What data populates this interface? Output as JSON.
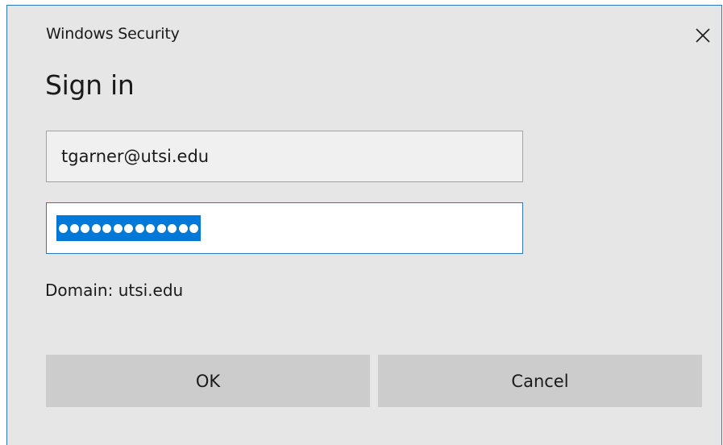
{
  "window": {
    "title": "Windows Security",
    "close_icon": "close-icon"
  },
  "form": {
    "heading": "Sign in",
    "username_value": "tgarner@utsi.edu",
    "password_dot_count": 13,
    "password_selected": true,
    "domain_text": "Domain: utsi.edu"
  },
  "buttons": {
    "ok_label": "OK",
    "cancel_label": "Cancel"
  },
  "colors": {
    "accent": "#0078d7",
    "dialog_background": "#e6e6e6",
    "button_background": "#cccccc"
  }
}
